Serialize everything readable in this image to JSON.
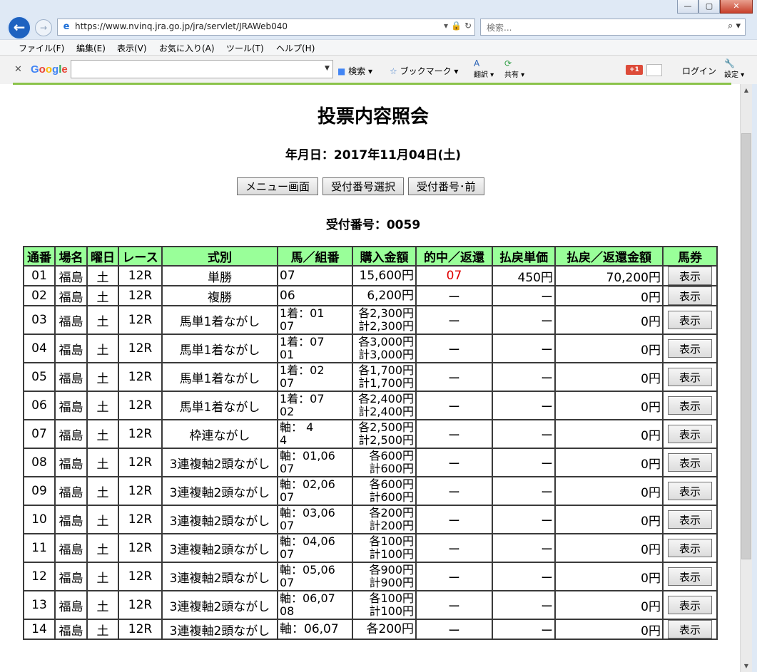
{
  "browser": {
    "url": "https://www.nvinq.jra.go.jp/jra/servlet/JRAWeb040",
    "search_placeholder": "検索...",
    "menu": [
      "ファイル(F)",
      "編集(E)",
      "表示(V)",
      "お気に入り(A)",
      "ツール(T)",
      "ヘルプ(H)"
    ],
    "google_toolbar": {
      "logo": "Google",
      "search_label": "検索",
      "bookmark_label": "ブックマーク",
      "translate_label": "翻訳",
      "share_label": "共有",
      "gplus_label": "+1",
      "login_label": "ログイン",
      "settings_label": "設定"
    },
    "accent_color": "#1e62c0"
  },
  "page": {
    "title": "投票内容照会",
    "date_line": "年月日：2017年11月04日(土)",
    "buttons": {
      "menu": "メニュー画面",
      "select": "受付番号選択",
      "prev": "受付番号･前"
    },
    "receipt_line": "受付番号：0059",
    "table": {
      "headers": [
        "通番",
        "場名",
        "曜日",
        "レース",
        "式別",
        "馬／組番",
        "購入金額",
        "的中／返還",
        "払戻単価",
        "払戻／返還金額",
        "馬券"
      ],
      "header_color": "#99ff99",
      "show_label": "表示",
      "rows": [
        {
          "no": "01",
          "venue": "福島",
          "day": "土",
          "race": "12R",
          "type": "単勝",
          "combo1": "07",
          "combo2": "",
          "amt1": "15,600円",
          "amt2": "",
          "hit": "07",
          "unit": "450円",
          "payout": "70,200円"
        },
        {
          "no": "02",
          "venue": "福島",
          "day": "土",
          "race": "12R",
          "type": "複勝",
          "combo1": "06",
          "combo2": "",
          "amt1": "6,200円",
          "amt2": "",
          "hit": "ー",
          "unit": "ー",
          "payout": "0円"
        },
        {
          "no": "03",
          "venue": "福島",
          "day": "土",
          "race": "12R",
          "type": "馬単1着ながし",
          "combo1": "1着：01",
          "combo2": "07",
          "amt1": "各2,300円",
          "amt2": "計2,300円",
          "hit": "ー",
          "unit": "ー",
          "payout": "0円"
        },
        {
          "no": "04",
          "venue": "福島",
          "day": "土",
          "race": "12R",
          "type": "馬単1着ながし",
          "combo1": "1着：07",
          "combo2": "01",
          "amt1": "各3,000円",
          "amt2": "計3,000円",
          "hit": "ー",
          "unit": "ー",
          "payout": "0円"
        },
        {
          "no": "05",
          "venue": "福島",
          "day": "土",
          "race": "12R",
          "type": "馬単1着ながし",
          "combo1": "1着：02",
          "combo2": "07",
          "amt1": "各1,700円",
          "amt2": "計1,700円",
          "hit": "ー",
          "unit": "ー",
          "payout": "0円"
        },
        {
          "no": "06",
          "venue": "福島",
          "day": "土",
          "race": "12R",
          "type": "馬単1着ながし",
          "combo1": "1着：07",
          "combo2": "02",
          "amt1": "各2,400円",
          "amt2": "計2,400円",
          "hit": "ー",
          "unit": "ー",
          "payout": "0円"
        },
        {
          "no": "07",
          "venue": "福島",
          "day": "土",
          "race": "12R",
          "type": "枠連ながし",
          "combo1": "軸： 4",
          "combo2": "4",
          "amt1": "各2,500円",
          "amt2": "計2,500円",
          "hit": "ー",
          "unit": "ー",
          "payout": "0円"
        },
        {
          "no": "08",
          "venue": "福島",
          "day": "土",
          "race": "12R",
          "type": "3連複軸2頭ながし",
          "combo1": "軸：01,06",
          "combo2": "07",
          "amt1": "各600円",
          "amt2": "計600円",
          "hit": "ー",
          "unit": "ー",
          "payout": "0円"
        },
        {
          "no": "09",
          "venue": "福島",
          "day": "土",
          "race": "12R",
          "type": "3連複軸2頭ながし",
          "combo1": "軸：02,06",
          "combo2": "07",
          "amt1": "各600円",
          "amt2": "計600円",
          "hit": "ー",
          "unit": "ー",
          "payout": "0円"
        },
        {
          "no": "10",
          "venue": "福島",
          "day": "土",
          "race": "12R",
          "type": "3連複軸2頭ながし",
          "combo1": "軸：03,06",
          "combo2": "07",
          "amt1": "各200円",
          "amt2": "計200円",
          "hit": "ー",
          "unit": "ー",
          "payout": "0円"
        },
        {
          "no": "11",
          "venue": "福島",
          "day": "土",
          "race": "12R",
          "type": "3連複軸2頭ながし",
          "combo1": "軸：04,06",
          "combo2": "07",
          "amt1": "各100円",
          "amt2": "計100円",
          "hit": "ー",
          "unit": "ー",
          "payout": "0円"
        },
        {
          "no": "12",
          "venue": "福島",
          "day": "土",
          "race": "12R",
          "type": "3連複軸2頭ながし",
          "combo1": "軸：05,06",
          "combo2": "07",
          "amt1": "各900円",
          "amt2": "計900円",
          "hit": "ー",
          "unit": "ー",
          "payout": "0円"
        },
        {
          "no": "13",
          "venue": "福島",
          "day": "土",
          "race": "12R",
          "type": "3連複軸2頭ながし",
          "combo1": "軸：06,07",
          "combo2": "08",
          "amt1": "各100円",
          "amt2": "計100円",
          "hit": "ー",
          "unit": "ー",
          "payout": "0円"
        },
        {
          "no": "14",
          "venue": "福島",
          "day": "土",
          "race": "12R",
          "type": "3連複軸2頭ながし",
          "combo1": "軸：06,07",
          "combo2": "",
          "amt1": "各200円",
          "amt2": "",
          "hit": "ー",
          "unit": "ー",
          "payout": "0円"
        }
      ]
    }
  }
}
